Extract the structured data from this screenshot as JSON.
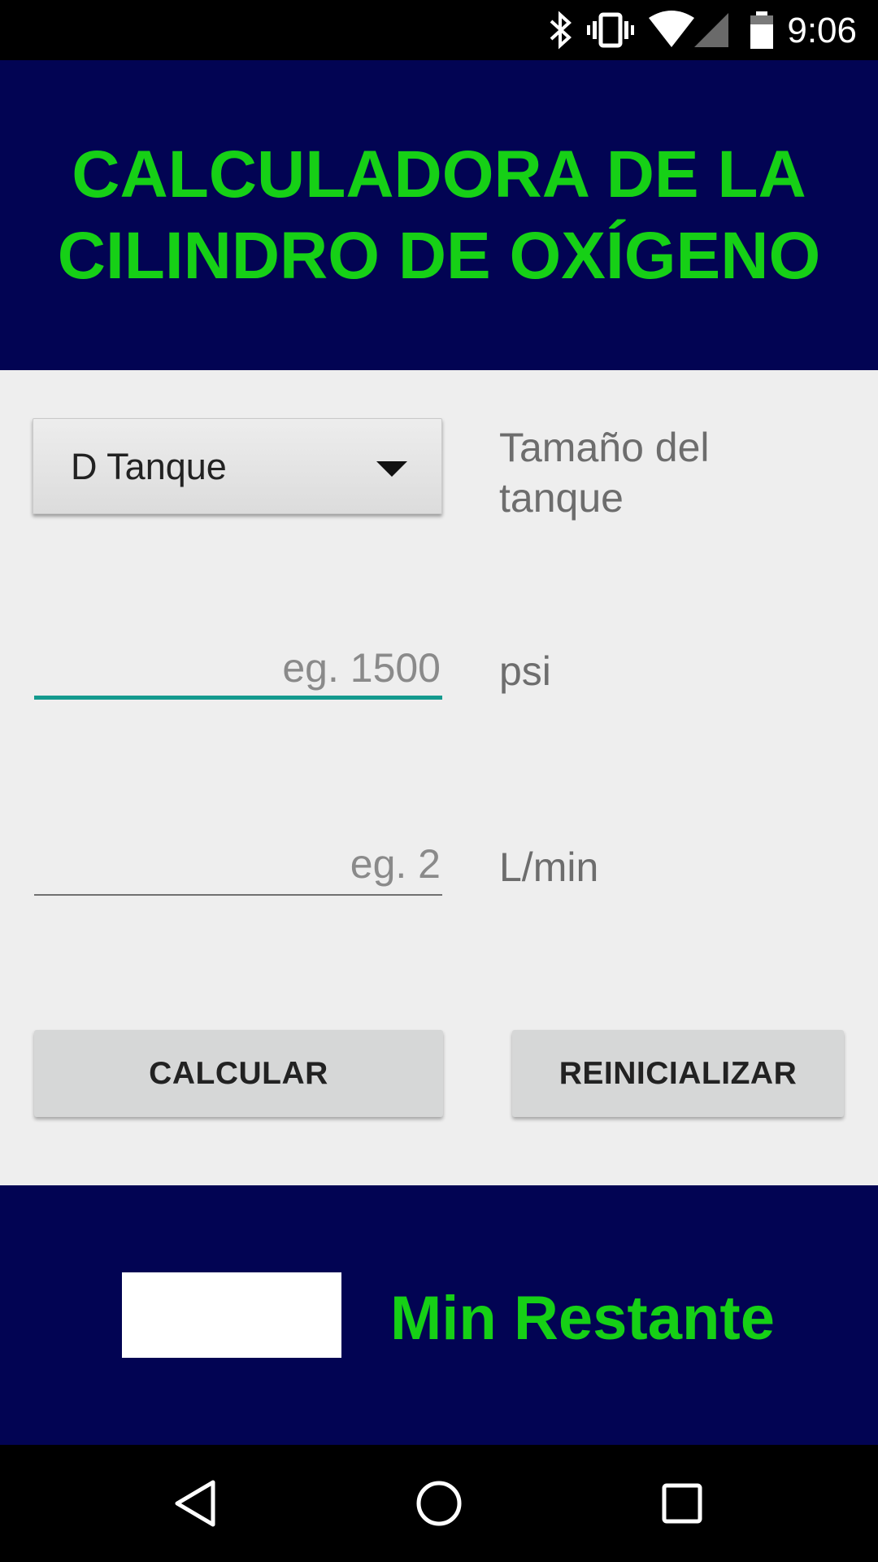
{
  "status_bar": {
    "time": "9:06",
    "icons": [
      "bluetooth-icon",
      "vibrate-icon",
      "wifi-icon",
      "signal-icon",
      "battery-icon"
    ]
  },
  "header": {
    "title": "CALCULADORA DE LA\nCILINDRO DE OXÍGENO"
  },
  "form": {
    "tank_spinner": {
      "selected": "D Tanque"
    },
    "tank_label": "Tamaño del\ntanque",
    "pressure": {
      "placeholder": "eg. 1500",
      "value": "",
      "unit": "psi"
    },
    "flow": {
      "placeholder": "eg. 2",
      "value": "",
      "unit": "L/min"
    },
    "buttons": {
      "calculate": "CALCULAR",
      "reset": "REINICIALIZAR"
    }
  },
  "result": {
    "value": "",
    "label": "Min Restante"
  },
  "nav_bar": {
    "icons": [
      "back-icon",
      "home-icon",
      "recents-icon"
    ]
  },
  "colors": {
    "header_bg": "#020453",
    "accent_green": "#16d016",
    "field_focus": "#149a8e",
    "form_bg": "#eeeeee"
  }
}
